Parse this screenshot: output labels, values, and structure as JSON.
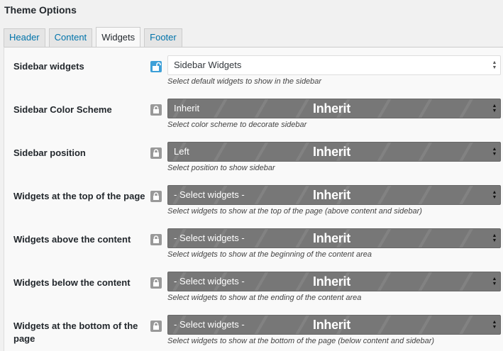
{
  "title": "Theme Options",
  "tabs": [
    {
      "label": "Header",
      "active": false
    },
    {
      "label": "Content",
      "active": false
    },
    {
      "label": "Widgets",
      "active": true
    },
    {
      "label": "Footer",
      "active": false
    }
  ],
  "inherit_label": "Inherit",
  "rows": [
    {
      "label": "Sidebar widgets",
      "value": "Sidebar Widgets",
      "description": "Select default widgets to show in the sidebar",
      "locked": false,
      "inherited": false
    },
    {
      "label": "Sidebar Color Scheme",
      "value": "Inherit",
      "description": "Select color scheme to decorate sidebar",
      "locked": true,
      "inherited": true
    },
    {
      "label": "Sidebar position",
      "value": "Left",
      "description": "Select position to show sidebar",
      "locked": true,
      "inherited": true
    },
    {
      "label": "Widgets at the top of the page",
      "value": "- Select widgets -",
      "description": "Select widgets to show at the top of the page (above content and sidebar)",
      "locked": true,
      "inherited": true
    },
    {
      "label": "Widgets above the content",
      "value": "- Select widgets -",
      "description": "Select widgets to show at the beginning of the content area",
      "locked": true,
      "inherited": true
    },
    {
      "label": "Widgets below the content",
      "value": "- Select widgets -",
      "description": "Select widgets to show at the ending of the content area",
      "locked": true,
      "inherited": true
    },
    {
      "label": "Widgets at the bottom of the page",
      "value": "- Select widgets -",
      "description": "Select widgets to show at the bottom of the page (below content and sidebar)",
      "locked": true,
      "inherited": true
    }
  ]
}
